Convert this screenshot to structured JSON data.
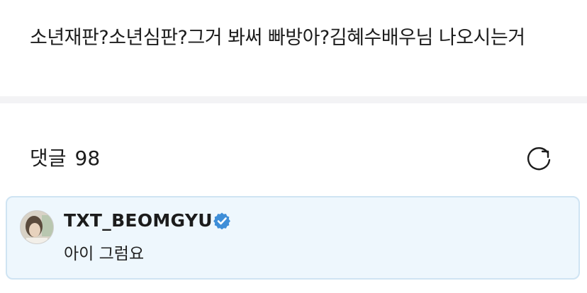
{
  "post": {
    "body": "소년재판?소년심판?그거 봐써 빠방아?김혜수배우님 나오시는거"
  },
  "comments": {
    "label": "댓글",
    "count": "98",
    "refresh_icon": "refresh-icon"
  },
  "comment": {
    "username": "TXT_BEOMGYU",
    "verified_icon": "verified-badge-icon",
    "text": "아이 그럼요"
  },
  "colors": {
    "card_bg": "#eef7fd",
    "card_border": "#cfe4f3",
    "verified": "#3e8ed8",
    "divider": "#f3f3f5"
  }
}
